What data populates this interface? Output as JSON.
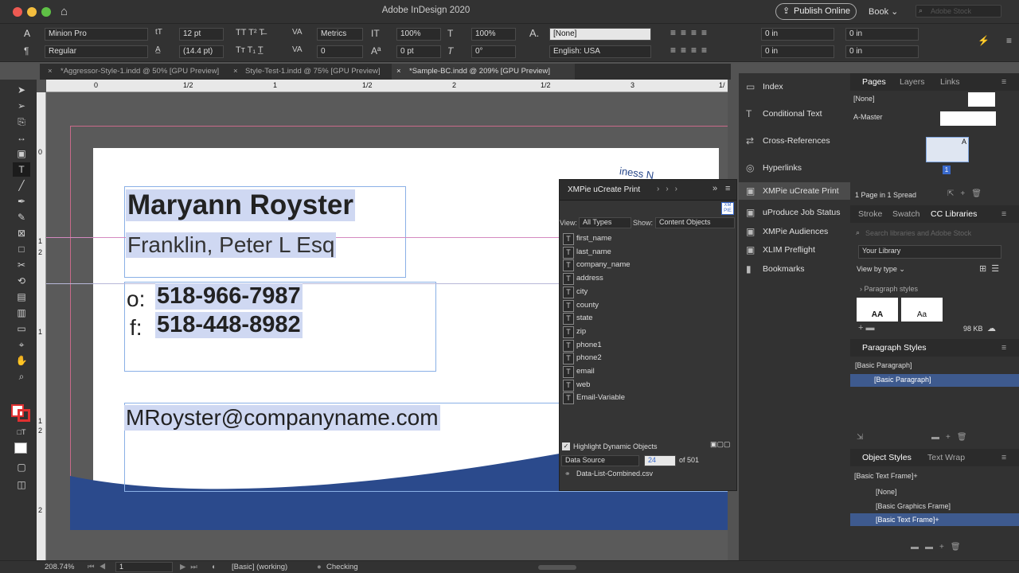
{
  "app": {
    "title": "Adobe InDesign 2020",
    "publish": "Publish Online",
    "workspace": "Book",
    "search_placeholder": "Adobe Stock"
  },
  "control": {
    "font_family": "Minion Pro",
    "font_style": "Regular",
    "font_size": "12 pt",
    "leading": "(14.4 pt)",
    "kerning": "Metrics",
    "tracking": "0",
    "vscale": "100%",
    "hscale": "100%",
    "baseline": "0 pt",
    "skew": "0°",
    "char_style": "[None]",
    "language": "English: USA",
    "indent1": "0 in",
    "indent2": "0 in",
    "indent3": "0 in",
    "indent4": "0 in"
  },
  "doc_tabs": [
    "*Aggressor-Style-1.indd @ 50% [GPU Preview]",
    "Style-Test-1.indd @ 75% [GPU Preview]",
    "*Sample-BC.indd @ 209% [GPU Preview]"
  ],
  "ruler": {
    "top": [
      "0",
      "1/2",
      "1",
      "1/2",
      "2",
      "1/2",
      "3",
      "1/"
    ],
    "left": [
      "0",
      "1",
      "2",
      "1",
      "1",
      "2",
      "2"
    ]
  },
  "card": {
    "name": "Maryann Royster",
    "company": "Franklin, Peter L Esq",
    "office_label": "o:",
    "office": "518-966-7987",
    "fax_label": "f:",
    "fax": "518-448-8982",
    "email": "MRoyster@companyname.com",
    "corner_text": "iness N"
  },
  "panels": {
    "items": [
      "Index",
      "Conditional Text",
      "Cross-References",
      "Hyperlinks",
      "XMPie uCreate Print",
      "uProduce Job Status",
      "XMPie Audiences",
      "XLIM Preflight",
      "Bookmarks"
    ]
  },
  "xmpie": {
    "title": "XMPie uCreate Print",
    "view_label": "View:",
    "view_value": "All Types",
    "show_label": "Show:",
    "show_value": "Content Objects",
    "fields": [
      "first_name",
      "last_name",
      "company_name",
      "address",
      "city",
      "county",
      "state",
      "zip",
      "phone1",
      "phone2",
      "email",
      "web",
      "Email-Variable"
    ],
    "highlight": "Highlight Dynamic Objects",
    "data_source": "Data Source",
    "record": "24",
    "of": "of 501",
    "file": "Data-List-Combined.csv",
    "logo": "XM PIE"
  },
  "pages": {
    "tabs": [
      "Pages",
      "Layers",
      "Links"
    ],
    "none": "[None]",
    "master": "A-Master",
    "master_letter": "A",
    "page_num": "1",
    "summary": "1 Page in 1 Spread"
  },
  "cclib": {
    "tabs": [
      "Stroke",
      "Swatch",
      "CC Libraries"
    ],
    "search": "Search libraries and Adobe Stock",
    "library": "Your Library",
    "view_by": "View by type",
    "section": "Paragraph styles",
    "thumb1": "AA",
    "thumb2": "Aa",
    "size": "98 KB"
  },
  "para_styles": {
    "title": "Paragraph Styles",
    "current": "[Basic Paragraph]",
    "items": [
      "[Basic Paragraph]"
    ]
  },
  "obj_styles": {
    "tabs": [
      "Object Styles",
      "Text Wrap"
    ],
    "current": "[Basic Text Frame]+",
    "items": [
      "[None]",
      "[Basic Graphics Frame]",
      "[Basic Text Frame]+"
    ]
  },
  "status": {
    "zoom": "208.74%",
    "page": "1",
    "style": "[Basic] (working)",
    "preflight": "Checking"
  },
  "colors": {
    "blue": "#2b4a8c",
    "selection": "#cfd8f2"
  }
}
